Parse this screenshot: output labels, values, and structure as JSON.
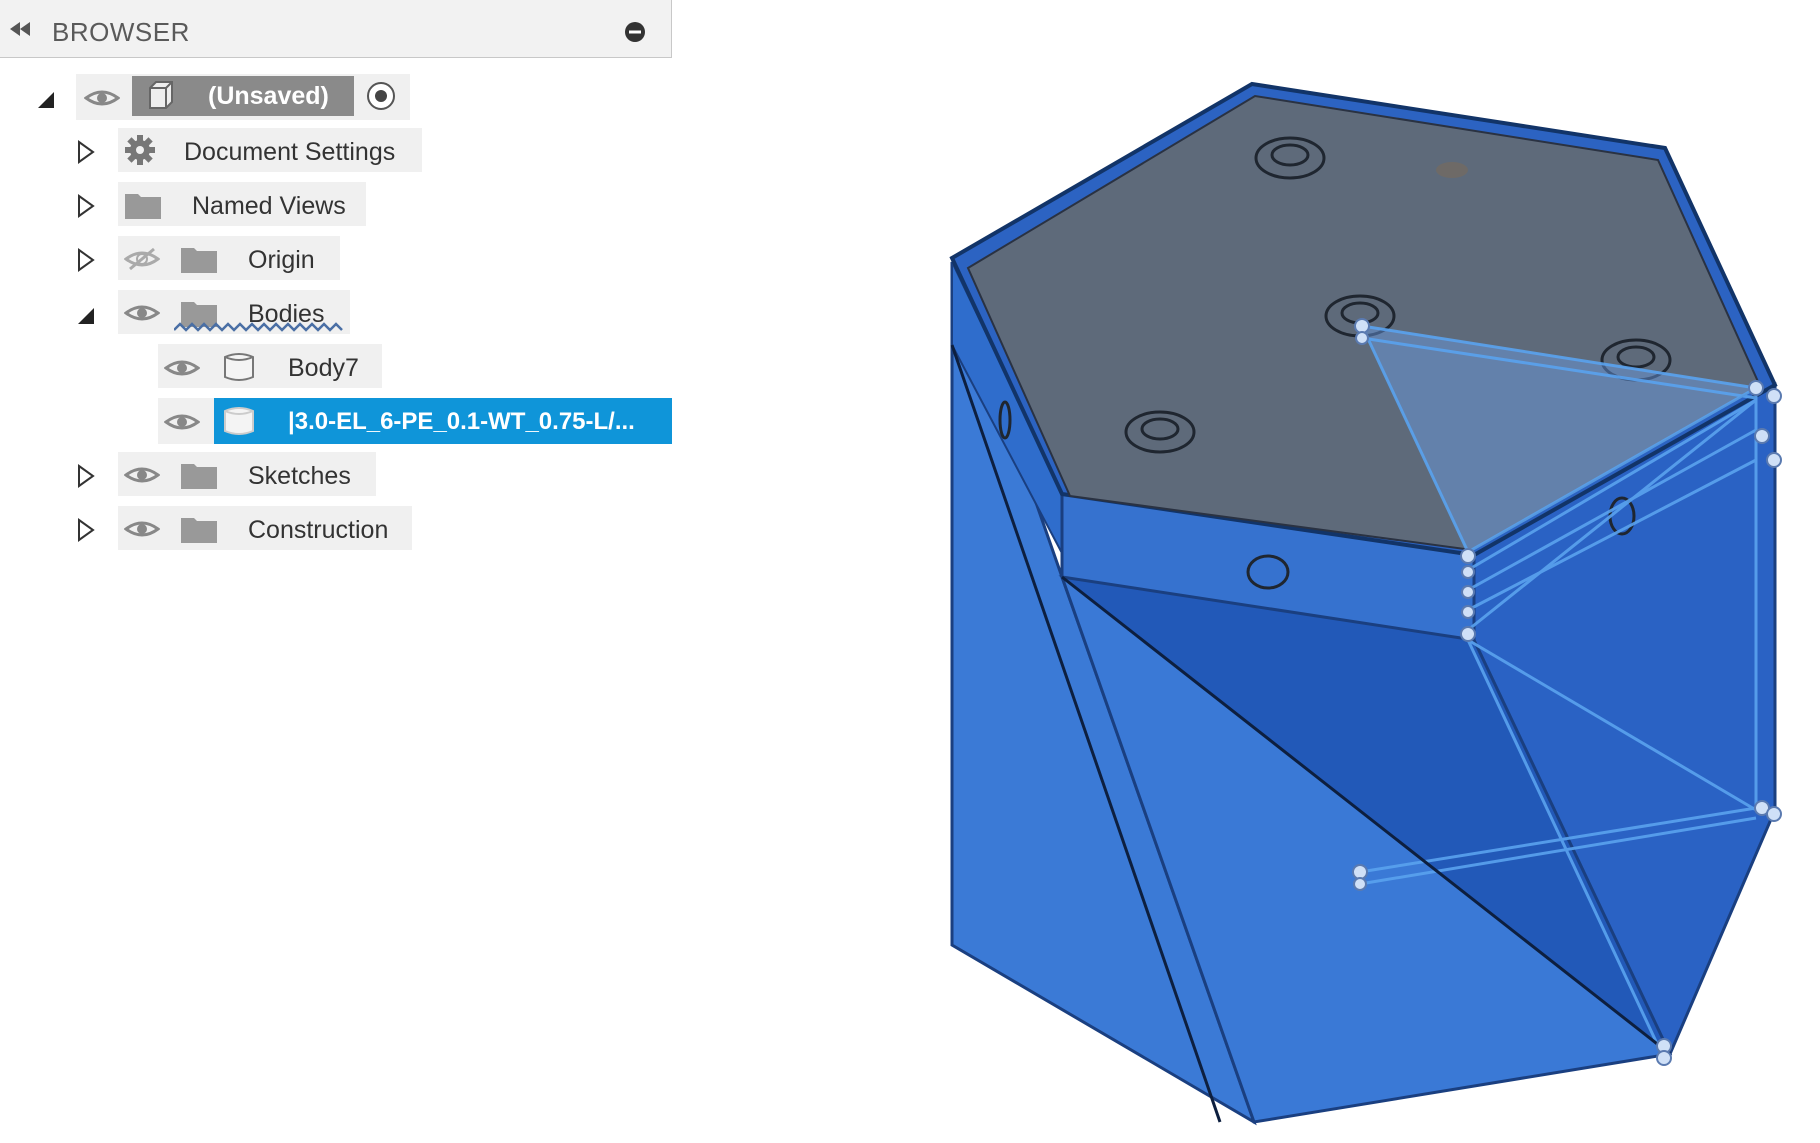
{
  "browser": {
    "title": "BROWSER",
    "root": {
      "label": "(Unsaved)"
    },
    "items": [
      {
        "label": "Document Settings",
        "icon": "gear-icon"
      },
      {
        "label": "Named Views",
        "icon": "folder-icon"
      },
      {
        "label": "Origin",
        "icon": "folder-icon",
        "visible": false
      },
      {
        "label": "Bodies",
        "icon": "folder-icon",
        "expanded": true
      },
      {
        "label": "Body7",
        "icon": "body-icon"
      },
      {
        "label": "|3.0-EL_6-PE_0.1-WT_0.75-L/...",
        "icon": "body-icon",
        "selected": true
      },
      {
        "label": "Sketches",
        "icon": "folder-icon"
      },
      {
        "label": "Construction",
        "icon": "folder-icon"
      }
    ]
  },
  "colors": {
    "selection": "#0f95d9",
    "body_blue": "#2f6fd0",
    "top_face": "#5f6a78"
  }
}
